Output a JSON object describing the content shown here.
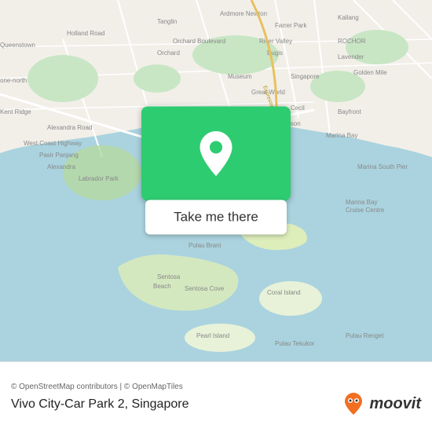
{
  "map": {
    "attribution": "© OpenStreetMap contributors | © OpenMapTiles",
    "location_name": "Vivo City-Car Park 2, Singapore",
    "button_label": "Take me there"
  },
  "moovit": {
    "label": "moovit"
  }
}
